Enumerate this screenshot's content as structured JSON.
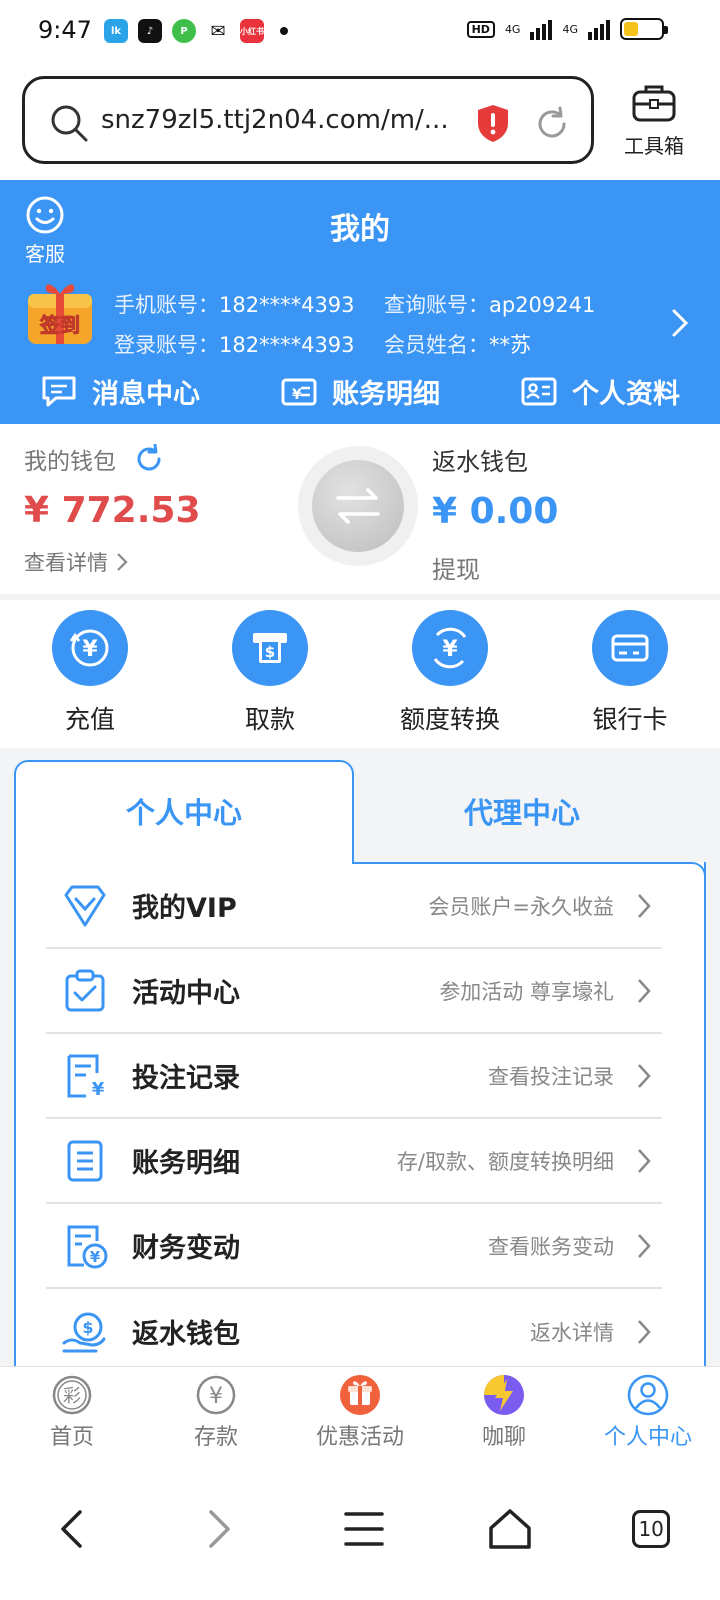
{
  "status_bar": {
    "time": "9:47",
    "hd": "HD",
    "net1": "4G",
    "net2": "4G",
    "app_badge": "lk",
    "app_xiaohongshu": "小红书",
    "battery_level": 0.4
  },
  "browser": {
    "url": "snz79zl5.ttj2n04.com/m/...",
    "toolbox_label": "工具箱"
  },
  "header": {
    "service_label": "客服",
    "title": "我的",
    "signin_label": "签到",
    "info": [
      {
        "key": "手机账号：",
        "value": "182****4393"
      },
      {
        "key": "查询账号：",
        "value": "ap209241"
      },
      {
        "key": "登录账号：",
        "value": "182****4393"
      },
      {
        "key": "会员姓名：",
        "value": "**苏"
      }
    ],
    "quick_links": [
      "消息中心",
      "账务明细",
      "个人资料"
    ]
  },
  "wallet": {
    "my_wallet_label": "我的钱包",
    "my_wallet_amount": "¥ 772.53",
    "view_detail": "查看详情",
    "rebate_label": "返水钱包",
    "rebate_amount": "¥ 0.00",
    "withdraw": "提现"
  },
  "actions": [
    "充值",
    "取款",
    "额度转换",
    "银行卡"
  ],
  "tabs": {
    "active": "个人中心",
    "other": "代理中心"
  },
  "menu": [
    {
      "label": "我的VIP",
      "hint": "会员账户=永久收益",
      "icon": "vip-diamond-icon"
    },
    {
      "label": "活动中心",
      "hint": "参加活动 尊享壕礼",
      "icon": "clipboard-check-icon"
    },
    {
      "label": "投注记录",
      "hint": "查看投注记录",
      "icon": "bet-record-icon"
    },
    {
      "label": "账务明细",
      "hint": "存/取款、额度转换明细",
      "icon": "ledger-icon"
    },
    {
      "label": "财务变动",
      "hint": "查看账务变动",
      "icon": "finance-change-icon"
    },
    {
      "label": "返水钱包",
      "hint": "返水详情",
      "icon": "rebate-wallet-icon"
    }
  ],
  "bottom_nav": [
    {
      "label": "首页",
      "icon": "lottery-icon",
      "glyph": "彩"
    },
    {
      "label": "存款",
      "icon": "yuan-icon",
      "glyph": "¥"
    },
    {
      "label": "优惠活动",
      "icon": "gift-icon",
      "glyph": ""
    },
    {
      "label": "咖聊",
      "icon": "lightning-icon",
      "glyph": ""
    },
    {
      "label": "个人中心",
      "icon": "user-icon",
      "glyph": ""
    }
  ],
  "system_nav": {
    "tab_count": "10"
  },
  "colors": {
    "primary": "#3b95f5",
    "amount_red": "#e04b4b",
    "background_gray": "#f3f4f6"
  }
}
